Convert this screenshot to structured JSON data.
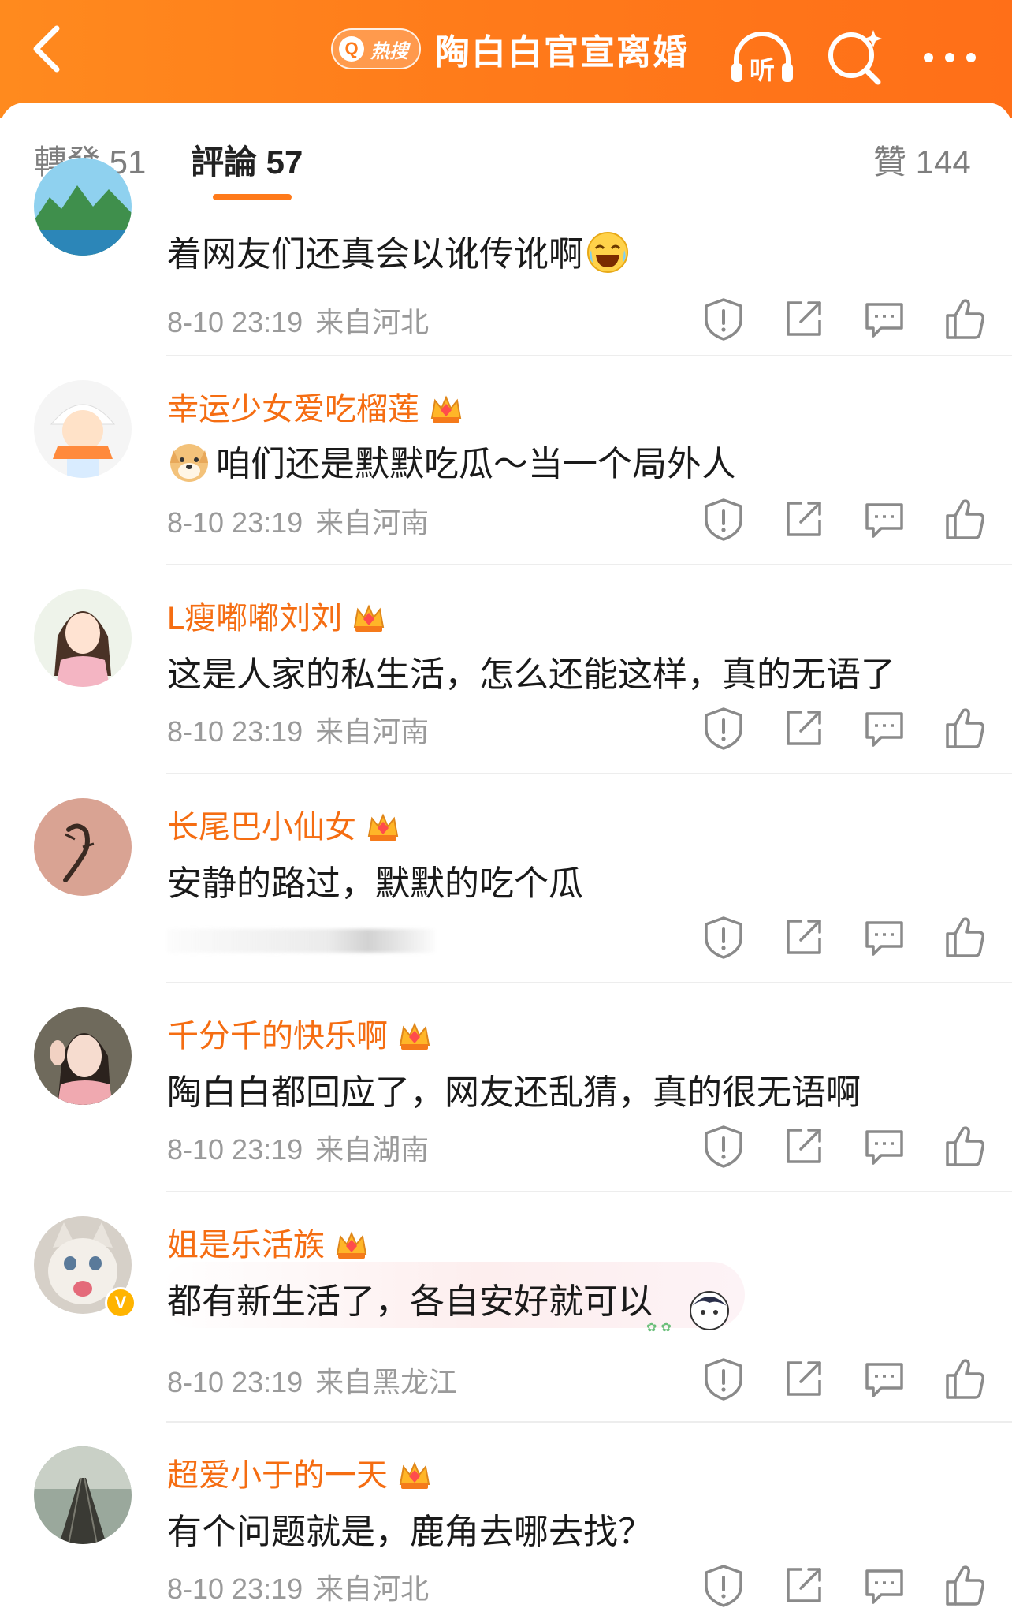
{
  "header": {
    "hot_search_label": "热搜",
    "title": "陶白白官宣离婚",
    "listen_label": "听",
    "colors": {
      "brand": "#ff7a1a",
      "username": "#f56d12"
    }
  },
  "tabs": {
    "repost": "轉發 51",
    "comments": "評論 57",
    "likes": "贊 144"
  },
  "comments": [
    {
      "username": "",
      "text": "着网友们还真会以讹传讹啊",
      "time": "8-10 23:19",
      "location": "来自河北",
      "avatar_icon": "landscape-avatar"
    },
    {
      "username": "幸运少女爱吃榴莲",
      "text": "咱们还是默默吃瓜～当一个局外人",
      "time": "8-10 23:19",
      "location": "来自河南",
      "avatar_icon": "cartoon-girl-avatar"
    },
    {
      "username": "L瘦嘟嘟刘刘",
      "text": "这是人家的私生活，怎么还能这样，真的无语了",
      "time": "8-10 23:19",
      "location": "来自河南",
      "avatar_icon": "doll-girl-avatar"
    },
    {
      "username": "长尾巴小仙女",
      "text": "安静的路过，默默的吃个瓜",
      "time": "",
      "location": "",
      "avatar_icon": "lizard-avatar"
    },
    {
      "username": "千分千的快乐啊",
      "text": "陶白白都回应了，网友还乱猜，真的很无语啊",
      "time": "8-10 23:19",
      "location": "来自湖南",
      "avatar_icon": "woman-photo-avatar"
    },
    {
      "username": "姐是乐活族",
      "text": "都有新生活了，各自安好就可以",
      "time": "8-10 23:19",
      "location": "来自黑龙江",
      "avatar_icon": "kitten-avatar"
    },
    {
      "username": "超爱小于的一天",
      "text": "有个问题就是，鹿角去哪去找？",
      "time": "8-10 23:19",
      "location": "来自河北",
      "avatar_icon": "railway-avatar"
    }
  ]
}
